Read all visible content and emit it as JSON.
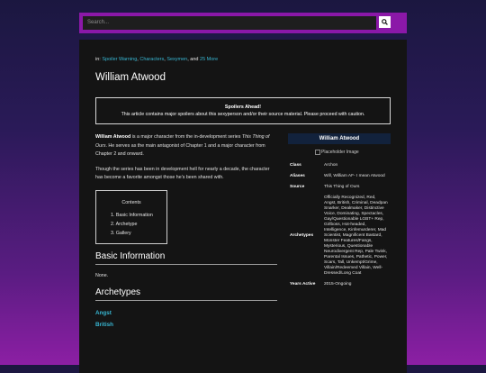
{
  "search": {
    "placeholder": "Search...",
    "icon": "search-icon"
  },
  "categories": {
    "prefix": "in:",
    "links": [
      "Spoiler Warning",
      "Characters",
      "Sexymen"
    ],
    "joiner": ", and",
    "more": "25 More"
  },
  "title": "William Atwood",
  "spoiler": {
    "heading": "Spoilers Ahead!",
    "text": "This article contains major spoilers about this sexyperson and/or their source material. Please proceed with caution."
  },
  "intro": {
    "name": "William Atwood",
    "text_a": "is a major character from the in-development series",
    "series": "This Thing of Ours",
    "text_b": ". He serves as the main antagonist of Chapter 1 and a major character from Chapter 2 and onward.",
    "para2": "Though the series has been in development hell for nearly a decade, the character has become a favorite amongst those he's been shared with."
  },
  "toc": {
    "title": "Contents",
    "items": [
      "1. Basic Information",
      "2. Archetype",
      "3. Gallery"
    ]
  },
  "basic_info": {
    "heading": "Basic Information",
    "text": "None."
  },
  "archetypes": {
    "heading": "Archetypes",
    "tags": [
      "Angst",
      "British"
    ]
  },
  "infobox": {
    "name": "William Atwood",
    "image_alt": "Placeholder Image",
    "rows": [
      {
        "key": "Class",
        "value": "Archon"
      },
      {
        "key": "Aliases",
        "value": "Will, William AF- I mean Atwood"
      },
      {
        "key": "Source",
        "value": "This Thing of Ours"
      },
      {
        "key": "Archetypes",
        "value": "Officially Recognized, Red, Angst, British, Criminal, Deadpan Snarker, Dealmaker, Distinctive Voice, Dominating, Spectacles, Gay/Questionable LGBT+ Rep, Girlboss, Hot-headed, Intelligence, Kinfemurderer, Mad Scientist, Magnificent Bastard, Monster Features/Fangs, Mysterious, Questionable Neurodivergent Rep, Pale Twink, Parental Issues, Pathetic, Power, Scars, Tall, Unkempt/Grime, Villain/Redeemed Villain, Well-Dressed/Long Coat"
      },
      {
        "key": "Years Active",
        "value": "2015-Ongoing"
      }
    ]
  },
  "colors": {
    "accent": "#8b18a8",
    "link": "#38b6d2",
    "panel": "#141414",
    "infobox_head": "#12223c"
  }
}
